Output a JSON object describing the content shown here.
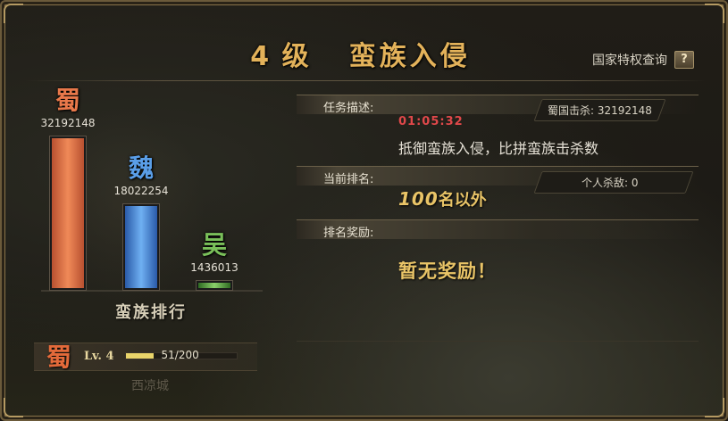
{
  "title": {
    "level": "4 级",
    "text": "蛮族入侵"
  },
  "privilege": {
    "label": "国家特权查询",
    "help": "?"
  },
  "chart_data": {
    "type": "bar",
    "categories": [
      "蜀",
      "魏",
      "吴"
    ],
    "values": [
      32192148,
      18022254,
      1436013
    ],
    "value_labels": [
      "32192148",
      "18022254",
      "1436013"
    ],
    "colors": [
      "#e8784a",
      "#5a9ee8",
      "#7ac05a"
    ],
    "title": "蛮族排行"
  },
  "player": {
    "nation_icon": "蜀",
    "level": "Lv. 4",
    "progress_text": "51/200",
    "progress_fraction": 0.255,
    "city": "西凉城"
  },
  "task": {
    "label": "任务描述:",
    "timer": "01:05:32",
    "description": "抵御蛮族入侵，比拼蛮族击杀数",
    "kills_box": "蜀国击杀: 32192148"
  },
  "ranking": {
    "label": "当前排名:",
    "number": "100",
    "suffix": "名以外",
    "kills_box": "个人杀敌: 0"
  },
  "reward": {
    "label": "排名奖励:",
    "value": "暂无奖励！"
  }
}
